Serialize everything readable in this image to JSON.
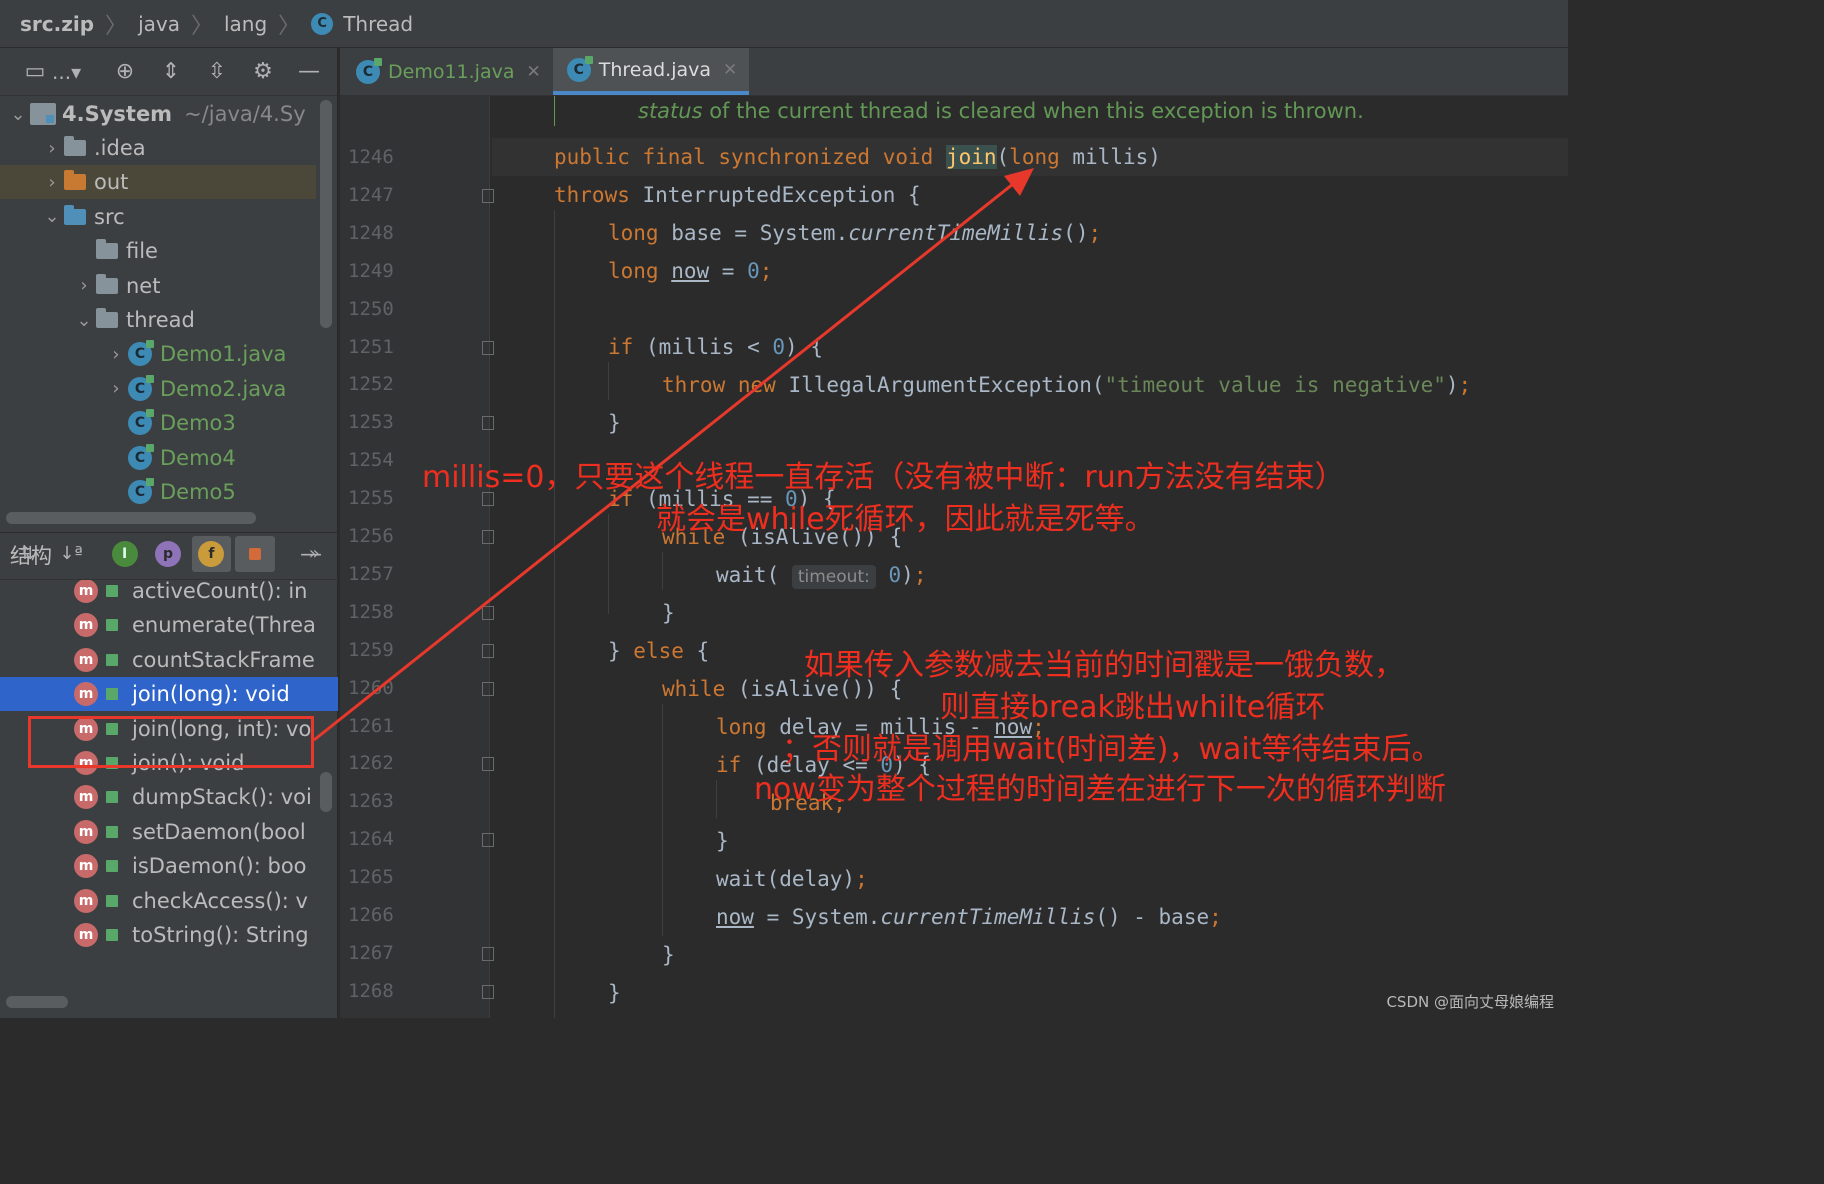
{
  "breadcrumb": [
    "src.zip",
    "java",
    "lang",
    "Thread"
  ],
  "project_panel": {
    "toolbar_dots": "...",
    "tree": {
      "root": {
        "label": "4.System",
        "path": "~/java/4.Sy"
      },
      "items": [
        {
          "label": ".idea",
          "kind": "folder",
          "arrow": "›"
        },
        {
          "label": "out",
          "kind": "folder-orange",
          "arrow": "›"
        },
        {
          "label": "src",
          "kind": "folder-blue",
          "arrow": "⌄"
        },
        {
          "label": "file",
          "kind": "package",
          "arrow": ""
        },
        {
          "label": "net",
          "kind": "package",
          "arrow": "›"
        },
        {
          "label": "thread",
          "kind": "package",
          "arrow": "⌄"
        },
        {
          "label": "Demo1.java",
          "kind": "class",
          "arrow": "›"
        },
        {
          "label": "Demo2.java",
          "kind": "class",
          "arrow": "›"
        },
        {
          "label": "Demo3",
          "kind": "class",
          "arrow": ""
        },
        {
          "label": "Demo4",
          "kind": "class",
          "arrow": ""
        },
        {
          "label": "Demo5",
          "kind": "class",
          "arrow": ""
        }
      ]
    }
  },
  "structure_panel": {
    "title": "结构",
    "members": [
      "activeCount(): in",
      "enumerate(Threa",
      "countStackFrame",
      "join(long): void",
      "join(long, int): vo",
      "join(): void",
      "dumpStack(): voi",
      "setDaemon(bool",
      "isDaemon(): boo",
      "checkAccess(): v",
      "toString(): String"
    ],
    "selected_index": 3
  },
  "editor": {
    "tabs": [
      {
        "label": "Demo11.java",
        "active": false
      },
      {
        "label": "Thread.java",
        "active": true
      }
    ],
    "doc_line": {
      "italic": "status",
      "rest": " of the current thread is cleared when this exception is thrown."
    },
    "line_numbers": [
      "1246",
      "1247",
      "1248",
      "1249",
      "1250",
      "1251",
      "1252",
      "1253",
      "1254",
      "1255",
      "1256",
      "1257",
      "1258",
      "1259",
      "1260",
      "1261",
      "1262",
      "1263",
      "1264",
      "1265",
      "1266",
      "1267",
      "1268"
    ],
    "param_hint": "timeout:",
    "string_literal": "\"timeout value is negative\""
  },
  "annotations": {
    "a1_line1": "millis=0，只要这个线程一直存活（没有被中断：run方法没有结束）",
    "a1_line2": "就会是while死循环，因此就是死等。",
    "a2_line1": "如果传入参数减去当前的时间戳是一饿负数，",
    "a2_line2": "则直接break跳出whilte循环",
    "a2_line3": "；否则就是调用wait(时间差)，wait等待结束后。",
    "a2_line4": "now变为整个过程的时间差在进行下一次的循环判断"
  },
  "watermark": "CSDN @面向丈母娘编程",
  "colors": {
    "annotation": "#ee2e1f",
    "selection": "#2f65ca",
    "keyword": "#cc7832",
    "number": "#6897bb",
    "string": "#6a8759"
  }
}
